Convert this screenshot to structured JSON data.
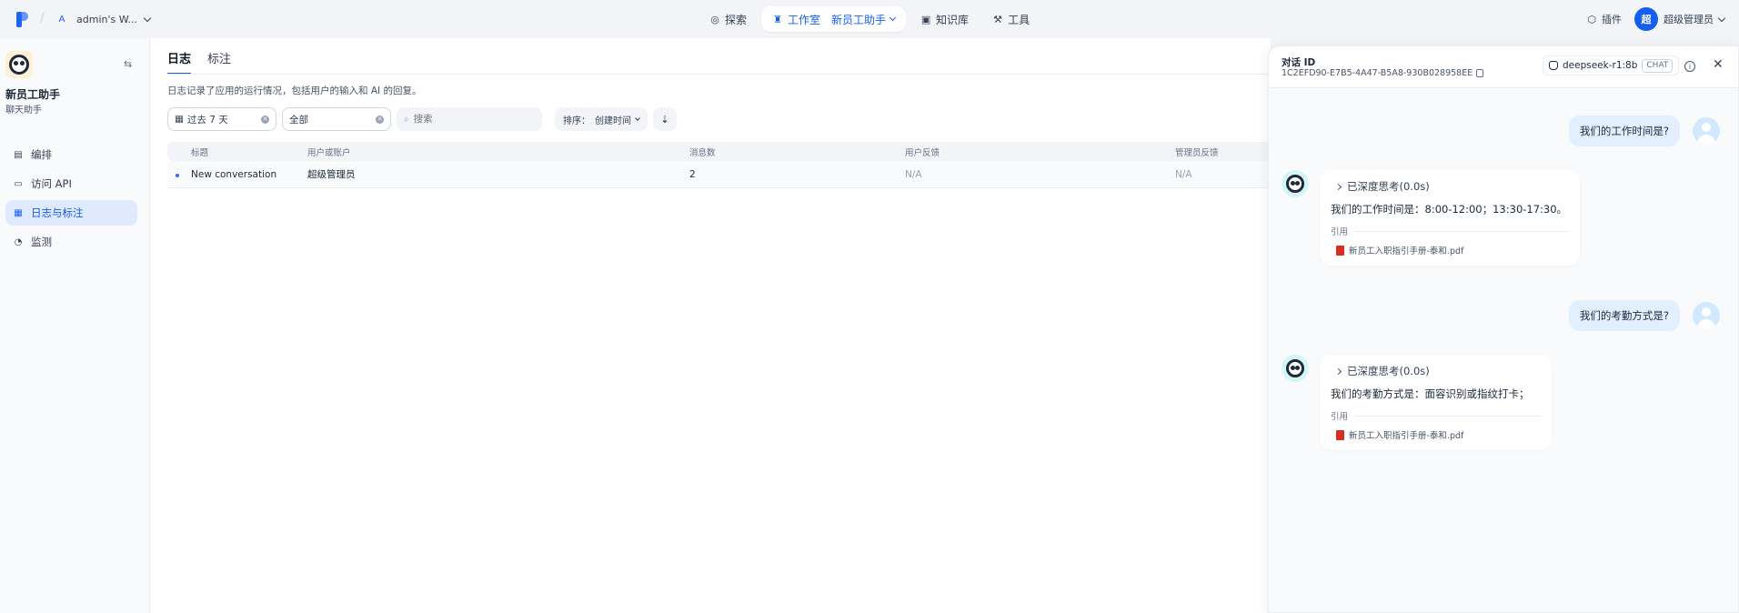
{
  "topbar": {
    "workspace_letter": "A",
    "workspace_name": "admin's W...",
    "nav": {
      "explore": "探索",
      "studio": "工作室",
      "current_app": "新员工助手",
      "knowledge": "知识库",
      "tools": "工具"
    },
    "plugins": "插件",
    "user_avatar": "超",
    "user_name": "超级管理员"
  },
  "sidebar": {
    "app_name": "新员工助手",
    "app_type": "聊天助手",
    "items": [
      {
        "label": "编排",
        "icon": "layout-icon"
      },
      {
        "label": "访问 API",
        "icon": "terminal-icon"
      },
      {
        "label": "日志与标注",
        "icon": "file-text-icon",
        "active": true
      },
      {
        "label": "监测",
        "icon": "gauge-icon"
      }
    ]
  },
  "main": {
    "tabs": [
      "日志",
      "标注"
    ],
    "description": "日志记录了应用的运行情况，包括用户的输入和 AI 的回复。",
    "filters": {
      "period": "过去 7 天",
      "status": "全部",
      "search_placeholder": "搜索",
      "sort_label": "排序：",
      "sort_value": "创建时间"
    },
    "table": {
      "headers": [
        "标题",
        "用户或账户",
        "消息数",
        "用户反馈",
        "管理员反馈"
      ],
      "rows": [
        {
          "title": "New conversation",
          "user": "超级管理员",
          "messages": "2",
          "user_feedback": "N/A",
          "admin_feedback": "N/A"
        }
      ]
    }
  },
  "drawer": {
    "label": "对话 ID",
    "conversation_id": "1C2EFD90-E7B5-4A47-B5A8-930B028958EE",
    "model": "deepseek-r1:8b",
    "model_tag": "CHAT",
    "messages": [
      {
        "question": "我们的工作时间是?",
        "thinking": "已深度思考(0.0s)",
        "answer": "我们的工作时间是：8:00-12:00；13:30-17:30。",
        "cite_label": "引用",
        "file": "新员工入职指引手册-泰和.pdf"
      },
      {
        "question": "我们的考勤方式是?",
        "thinking": "已深度思考(0.0s)",
        "answer": "我们的考勤方式是：面容识别或指纹打卡；",
        "cite_label": "引用",
        "file": "新员工入职指引手册-泰和.pdf"
      }
    ]
  },
  "colors": {
    "accent": "#155eef",
    "active_bg": "#e0eaff",
    "user_bubble": "#e1effe",
    "pdf_red": "#d92d20"
  }
}
